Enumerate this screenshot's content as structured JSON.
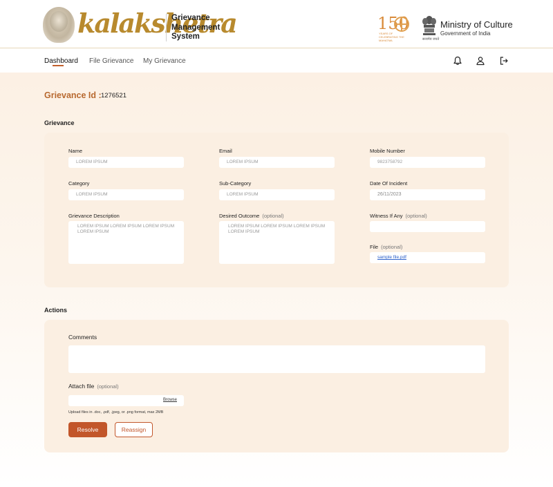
{
  "header": {
    "logo_text": "kalakshetra",
    "app_title_line1": "Grievance",
    "app_title_line2": "Management",
    "app_title_line3": "System",
    "anniversary_number": "150",
    "anniversary_text": "YEARS OF CELEBRATING THE MAHATMA",
    "ministry_title": "Ministry of Culture",
    "ministry_subtitle": "Government of India",
    "emblem_caption": "सत्यमेव जयते"
  },
  "nav": {
    "items": [
      {
        "label": "Dashboard",
        "active": true
      },
      {
        "label": "File Grievance",
        "active": false
      },
      {
        "label": "My Grievance",
        "active": false
      }
    ],
    "icons": [
      "bell-icon",
      "user-icon",
      "logout-icon"
    ]
  },
  "grievance": {
    "id_label": "Grievance Id :",
    "id_value": "1276521",
    "section_title": "Grievance",
    "name_label": "Name",
    "name_value": "LOREM IPSUM",
    "email_label": "Email",
    "email_value": "LOREM IPSUM",
    "mobile_label": "Mobile Number",
    "mobile_value": "9823758792",
    "category_label": "Category",
    "category_value": "LOREM IPSUM",
    "subcategory_label": "Sub-Category",
    "subcategory_value": "LOREM IPSUM",
    "date_label": "Date Of Incident",
    "date_value": "26/11/2023",
    "description_label": "Grievance Description",
    "description_value": "LOREM IPSUM LOREM IPSUM  LOREM IPSUM  LOREM IPSUM",
    "outcome_label": "Desired Outcome",
    "outcome_optional": "(optional)",
    "outcome_value": "LOREM IPSUM LOREM IPSUM  LOREM IPSUM  LOREM IPSUM",
    "witness_label": "Witness If Any",
    "witness_optional": "(optional)",
    "witness_value": "",
    "file_label": "File",
    "file_optional": "(optional)",
    "file_value": "sample file.pdf"
  },
  "actions": {
    "section_title": "Actions",
    "comments_label": "Comments",
    "comments_value": "",
    "attach_label": "Attach file",
    "attach_optional": "(optional)",
    "browse_label": "Browse",
    "upload_hint": "Upload files in .doc, .pdf, .jpeg, or .png format, max 2MB",
    "resolve_label": "Resolve",
    "reassign_label": "Reassign"
  },
  "colors": {
    "accent": "#c2562a",
    "id_label": "#b8692f",
    "card_bg": "#fbefe2",
    "link": "#2b5fc9"
  }
}
